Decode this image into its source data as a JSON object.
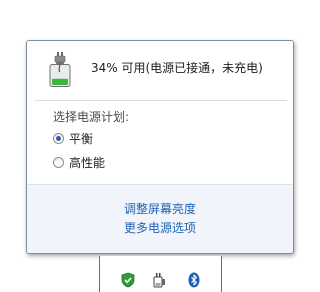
{
  "power_flyout": {
    "status_text": "34% 可用(电源已接通，未充电)",
    "battery_percent": 34,
    "plan_heading": "选择电源计划:",
    "plans": [
      {
        "label": "平衡",
        "selected": true
      },
      {
        "label": "高性能",
        "selected": false
      }
    ],
    "links": {
      "adjust_brightness": "调整屏幕亮度",
      "more_options": "更多电源选项"
    }
  },
  "tray": {
    "icons": [
      "security-shield-icon",
      "power-plug-icon",
      "bluetooth-icon"
    ]
  },
  "colors": {
    "link": "#1f63b4",
    "battery_fill": "#3cb83c",
    "radio_dot": "#2a5db0",
    "bluetooth_blue": "#1d5fb8"
  }
}
